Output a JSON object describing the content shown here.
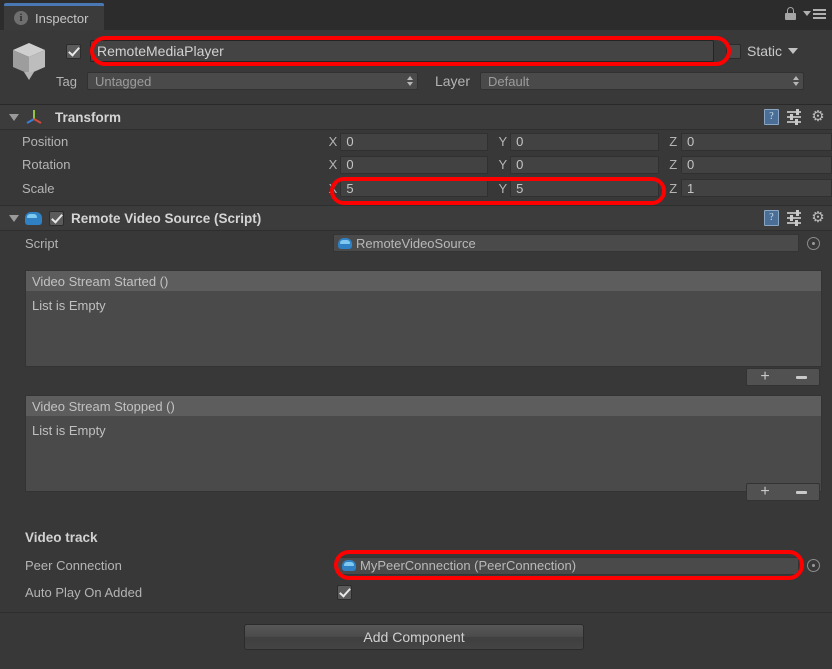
{
  "window": {
    "tab_label": "Inspector",
    "tab_icon": "info-icon",
    "lock_icon": "lock-icon",
    "menu_icon": "hamburger-menu-icon"
  },
  "object_header": {
    "icon": "cube-icon",
    "enabled": true,
    "name": "RemoteMediaPlayer",
    "static_label": "Static",
    "tag_label": "Tag",
    "tag_value": "Untagged",
    "layer_label": "Layer",
    "layer_value": "Default"
  },
  "transform": {
    "title": "Transform",
    "icon": "transform-axis-icon",
    "rows": [
      {
        "label": "Position",
        "x_axis": "X",
        "x": "0",
        "y_axis": "Y",
        "y": "0",
        "z_axis": "Z",
        "z": "0"
      },
      {
        "label": "Rotation",
        "x_axis": "X",
        "x": "0",
        "y_axis": "Y",
        "y": "0",
        "z_axis": "Z",
        "z": "0"
      },
      {
        "label": "Scale",
        "x_axis": "X",
        "x": "5",
        "y_axis": "Y",
        "y": "5",
        "z_axis": "Z",
        "z": "1"
      }
    ]
  },
  "script_component": {
    "title": "Remote Video Source (Script)",
    "icon": "cs-script-icon",
    "enabled": true,
    "script_label": "Script",
    "script_value": "RemoteVideoSource",
    "events": [
      {
        "header": "Video Stream Started ()",
        "empty_text": "List is Empty",
        "add_label": "+",
        "remove_label": "-"
      },
      {
        "header": "Video Stream Stopped ()",
        "empty_text": "List is Empty",
        "add_label": "+",
        "remove_label": "-"
      }
    ],
    "section_title": "Video track",
    "peer_connection_label": "Peer Connection",
    "peer_connection_value": "MyPeerConnection (PeerConnection)",
    "auto_play_label": "Auto Play On Added",
    "auto_play_checked": true
  },
  "footer": {
    "add_component_label": "Add Component"
  },
  "colors": {
    "annotation": "#fe0000",
    "tab_accent": "#4a78b4",
    "background": "#383838",
    "script_blue": "#2f81c4"
  }
}
